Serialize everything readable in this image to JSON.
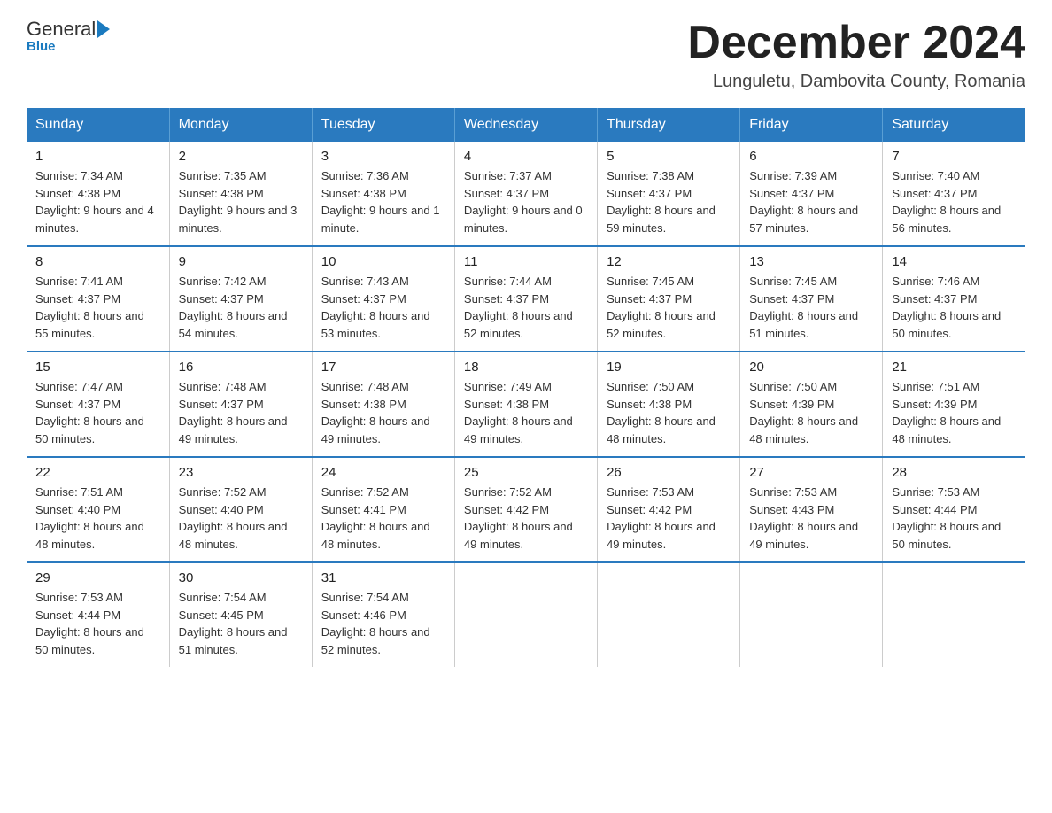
{
  "logo": {
    "general": "General",
    "arrow": "▶",
    "blue": "Blue"
  },
  "title": "December 2024",
  "subtitle": "Lunguletu, Dambovita County, Romania",
  "weekdays": [
    "Sunday",
    "Monday",
    "Tuesday",
    "Wednesday",
    "Thursday",
    "Friday",
    "Saturday"
  ],
  "weeks": [
    [
      {
        "day": "1",
        "sunrise": "7:34 AM",
        "sunset": "4:38 PM",
        "daylight": "9 hours and 4 minutes."
      },
      {
        "day": "2",
        "sunrise": "7:35 AM",
        "sunset": "4:38 PM",
        "daylight": "9 hours and 3 minutes."
      },
      {
        "day": "3",
        "sunrise": "7:36 AM",
        "sunset": "4:38 PM",
        "daylight": "9 hours and 1 minute."
      },
      {
        "day": "4",
        "sunrise": "7:37 AM",
        "sunset": "4:37 PM",
        "daylight": "9 hours and 0 minutes."
      },
      {
        "day": "5",
        "sunrise": "7:38 AM",
        "sunset": "4:37 PM",
        "daylight": "8 hours and 59 minutes."
      },
      {
        "day": "6",
        "sunrise": "7:39 AM",
        "sunset": "4:37 PM",
        "daylight": "8 hours and 57 minutes."
      },
      {
        "day": "7",
        "sunrise": "7:40 AM",
        "sunset": "4:37 PM",
        "daylight": "8 hours and 56 minutes."
      }
    ],
    [
      {
        "day": "8",
        "sunrise": "7:41 AM",
        "sunset": "4:37 PM",
        "daylight": "8 hours and 55 minutes."
      },
      {
        "day": "9",
        "sunrise": "7:42 AM",
        "sunset": "4:37 PM",
        "daylight": "8 hours and 54 minutes."
      },
      {
        "day": "10",
        "sunrise": "7:43 AM",
        "sunset": "4:37 PM",
        "daylight": "8 hours and 53 minutes."
      },
      {
        "day": "11",
        "sunrise": "7:44 AM",
        "sunset": "4:37 PM",
        "daylight": "8 hours and 52 minutes."
      },
      {
        "day": "12",
        "sunrise": "7:45 AM",
        "sunset": "4:37 PM",
        "daylight": "8 hours and 52 minutes."
      },
      {
        "day": "13",
        "sunrise": "7:45 AM",
        "sunset": "4:37 PM",
        "daylight": "8 hours and 51 minutes."
      },
      {
        "day": "14",
        "sunrise": "7:46 AM",
        "sunset": "4:37 PM",
        "daylight": "8 hours and 50 minutes."
      }
    ],
    [
      {
        "day": "15",
        "sunrise": "7:47 AM",
        "sunset": "4:37 PM",
        "daylight": "8 hours and 50 minutes."
      },
      {
        "day": "16",
        "sunrise": "7:48 AM",
        "sunset": "4:37 PM",
        "daylight": "8 hours and 49 minutes."
      },
      {
        "day": "17",
        "sunrise": "7:48 AM",
        "sunset": "4:38 PM",
        "daylight": "8 hours and 49 minutes."
      },
      {
        "day": "18",
        "sunrise": "7:49 AM",
        "sunset": "4:38 PM",
        "daylight": "8 hours and 49 minutes."
      },
      {
        "day": "19",
        "sunrise": "7:50 AM",
        "sunset": "4:38 PM",
        "daylight": "8 hours and 48 minutes."
      },
      {
        "day": "20",
        "sunrise": "7:50 AM",
        "sunset": "4:39 PM",
        "daylight": "8 hours and 48 minutes."
      },
      {
        "day": "21",
        "sunrise": "7:51 AM",
        "sunset": "4:39 PM",
        "daylight": "8 hours and 48 minutes."
      }
    ],
    [
      {
        "day": "22",
        "sunrise": "7:51 AM",
        "sunset": "4:40 PM",
        "daylight": "8 hours and 48 minutes."
      },
      {
        "day": "23",
        "sunrise": "7:52 AM",
        "sunset": "4:40 PM",
        "daylight": "8 hours and 48 minutes."
      },
      {
        "day": "24",
        "sunrise": "7:52 AM",
        "sunset": "4:41 PM",
        "daylight": "8 hours and 48 minutes."
      },
      {
        "day": "25",
        "sunrise": "7:52 AM",
        "sunset": "4:42 PM",
        "daylight": "8 hours and 49 minutes."
      },
      {
        "day": "26",
        "sunrise": "7:53 AM",
        "sunset": "4:42 PM",
        "daylight": "8 hours and 49 minutes."
      },
      {
        "day": "27",
        "sunrise": "7:53 AM",
        "sunset": "4:43 PM",
        "daylight": "8 hours and 49 minutes."
      },
      {
        "day": "28",
        "sunrise": "7:53 AM",
        "sunset": "4:44 PM",
        "daylight": "8 hours and 50 minutes."
      }
    ],
    [
      {
        "day": "29",
        "sunrise": "7:53 AM",
        "sunset": "4:44 PM",
        "daylight": "8 hours and 50 minutes."
      },
      {
        "day": "30",
        "sunrise": "7:54 AM",
        "sunset": "4:45 PM",
        "daylight": "8 hours and 51 minutes."
      },
      {
        "day": "31",
        "sunrise": "7:54 AM",
        "sunset": "4:46 PM",
        "daylight": "8 hours and 52 minutes."
      },
      null,
      null,
      null,
      null
    ]
  ],
  "labels": {
    "sunrise": "Sunrise:",
    "sunset": "Sunset:",
    "daylight": "Daylight:"
  }
}
